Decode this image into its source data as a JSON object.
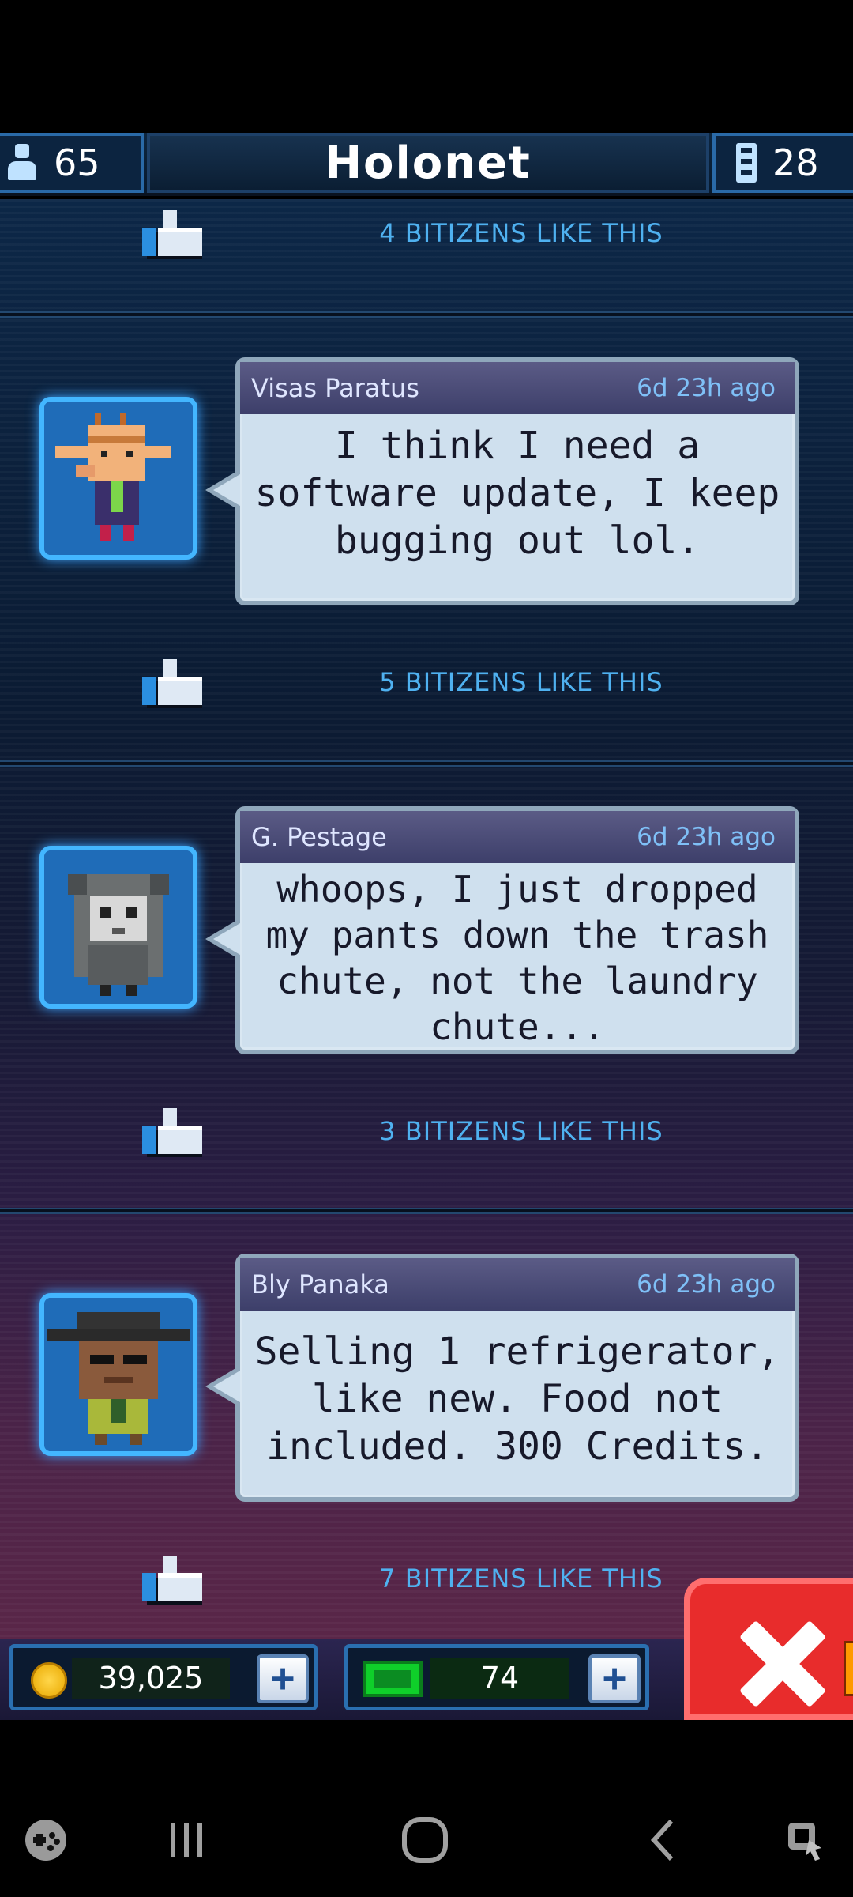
{
  "header": {
    "population": "65",
    "title": "Holonet",
    "floors": "28"
  },
  "first_like": "4 BITIZENS LIKE THIS",
  "posts": [
    {
      "author": "Visas Paratus",
      "time": "6d 23h ago",
      "message": "I think I need a software update, I keep bugging out lol.",
      "likes": "5 BITIZENS LIKE THIS",
      "avatar": "bitizen-avatar"
    },
    {
      "author": "G. Pestage",
      "time": "6d 23h ago",
      "message": "whoops, I just dropped my pants down the trash chute, not the laundry chute...",
      "likes": "3 BITIZENS LIKE THIS",
      "avatar": "bitizen-avatar"
    },
    {
      "author": "Bly Panaka",
      "time": "6d 23h ago",
      "message": "Selling 1 refrigerator, like new. Food not included. 300 Credits.",
      "likes": "7 BITIZENS LIKE THIS",
      "avatar": "bitizen-avatar"
    }
  ],
  "resources": {
    "coins": "39,025",
    "bux": "74"
  },
  "colors": {
    "accent": "#43b6ff",
    "like_text": "#4fb1f0",
    "close": "#e82c2c"
  }
}
